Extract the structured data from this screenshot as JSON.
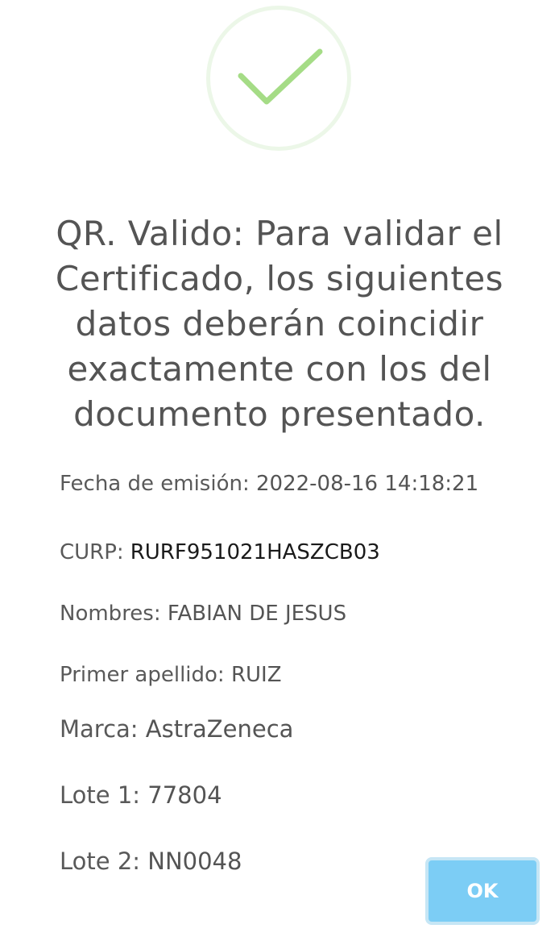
{
  "dialog": {
    "icon": "checkmark-icon",
    "colors": {
      "check": "#a5dc86",
      "check_ring": "#ecf7e8",
      "title_text": "#545454",
      "button_bg": "#7ccdf5",
      "button_text": "#ffffff"
    },
    "title": "QR. Valido: Para validar el Certificado, los siguientes datos deberán coincidir exactamente con los del documento presentado.",
    "fields": {
      "fecha": {
        "label": "Fecha de emisión:",
        "value": "2022-08-16 14:18:21"
      },
      "curp": {
        "label": "CURP:",
        "value": "RURF951021HASZCB03"
      },
      "nombres": {
        "label": "Nombres:",
        "value": "FABIAN DE JESUS"
      },
      "apellido": {
        "label": "Primer apellido:",
        "value": "RUIZ"
      },
      "marca": {
        "label": "Marca:",
        "value": "AstraZeneca"
      },
      "lote1": {
        "label": "Lote 1:",
        "value": "77804"
      },
      "lote2": {
        "label": "Lote 2:",
        "value": "NN0048"
      }
    },
    "ok_label": "OK"
  }
}
